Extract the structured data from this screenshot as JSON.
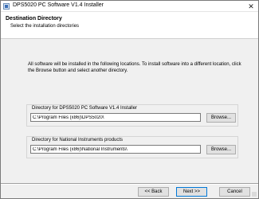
{
  "window": {
    "title": "DPS5020 PC Software V1.4 Installer",
    "close_symbol": "✕"
  },
  "header": {
    "title": "Destination Directory",
    "subtitle": "Select the installation directories"
  },
  "main": {
    "description": "All software will be installed in the following locations. To install software into a different location, click the Browse button and select another directory.",
    "groups": [
      {
        "label": "Directory for DPS5020 PC Software V1.4 Installer",
        "path": "C:\\Program Files (x86)\\DPS5020\\",
        "browse_label": "Browse..."
      },
      {
        "label": "Directory for National Instruments products",
        "path": "C:\\Program Files (x86)\\National Instruments\\",
        "browse_label": "Browse..."
      }
    ]
  },
  "footer": {
    "back_label": "<< Back",
    "next_label": "Next >>",
    "cancel_label": "Cancel"
  },
  "icons": {
    "app": "installer-icon",
    "close": "close-icon",
    "grip": "resize-grip-icon"
  },
  "colors": {
    "background": "#f0f0f0",
    "header": "#ffffff",
    "focus_border": "#0078d7"
  }
}
